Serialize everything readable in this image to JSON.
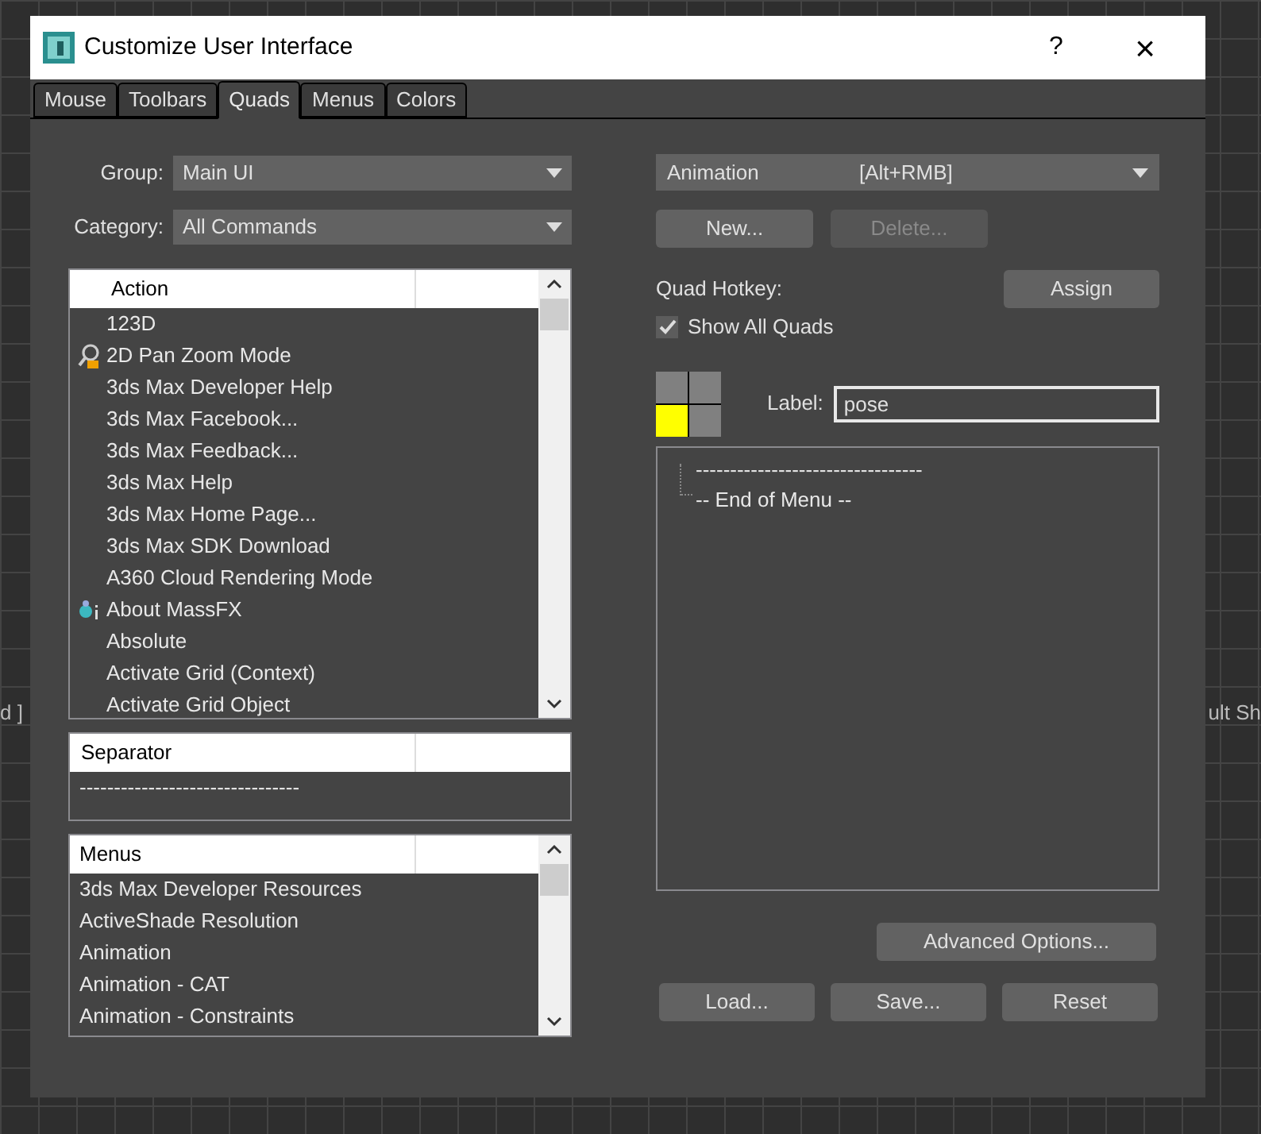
{
  "background": {
    "left_viewport_label": "d ]",
    "right_viewport_label": "ult Sh"
  },
  "window": {
    "title": "Customize User Interface",
    "help": "?",
    "close": "×"
  },
  "tabs": [
    {
      "label": "Mouse",
      "selected": false
    },
    {
      "label": "Toolbars",
      "selected": false
    },
    {
      "label": "Quads",
      "selected": true
    },
    {
      "label": "Menus",
      "selected": false
    },
    {
      "label": "Colors",
      "selected": false
    }
  ],
  "group": {
    "label": "Group:",
    "value": "Main UI"
  },
  "category": {
    "label": "Category:",
    "value": "All Commands"
  },
  "action_list": {
    "column": "Action",
    "items": [
      {
        "text": "123D"
      },
      {
        "text": "2D Pan Zoom Mode",
        "kind": "tool"
      },
      {
        "text": "3ds Max Developer Help"
      },
      {
        "text": "3ds Max Facebook..."
      },
      {
        "text": "3ds Max Feedback..."
      },
      {
        "text": "3ds Max Help"
      },
      {
        "text": "3ds Max Home Page..."
      },
      {
        "text": "3ds Max SDK Download"
      },
      {
        "text": "A360 Cloud Rendering Mode"
      },
      {
        "text": "About MassFX",
        "kind": "plugin"
      },
      {
        "text": "Absolute"
      },
      {
        "text": "Activate Grid (Context)"
      },
      {
        "text": "Activate Grid Object"
      }
    ]
  },
  "separator_list": {
    "column": "Separator",
    "items": [
      "--------------------------------"
    ]
  },
  "menus_list": {
    "column": "Menus",
    "items": [
      "3ds Max Developer Resources",
      "ActiveShade Resolution",
      "Animation",
      "Animation - CAT",
      "Animation - Constraints"
    ]
  },
  "quad_set": {
    "name": "Animation",
    "hotkey": "[Alt+RMB]"
  },
  "buttons_top": [
    {
      "label": "New...",
      "disabled": false
    },
    {
      "label": "Delete...",
      "disabled": true
    }
  ],
  "quad_hotkey_label": "Quad Hotkey:",
  "assign_button": "Assign",
  "show_all_quads": {
    "label": "Show All Quads",
    "checked": true
  },
  "quadrants": [
    {
      "selected": false
    },
    {
      "selected": false
    },
    {
      "selected": true
    },
    {
      "selected": false
    }
  ],
  "label_field": {
    "label": "Label:",
    "value": "pose"
  },
  "quad_menu_tree": [
    "---------------------------------",
    "-- End of Menu --"
  ],
  "advanced_button": "Advanced Options...",
  "buttons_bottom": [
    "Load...",
    "Save...",
    "Reset"
  ]
}
